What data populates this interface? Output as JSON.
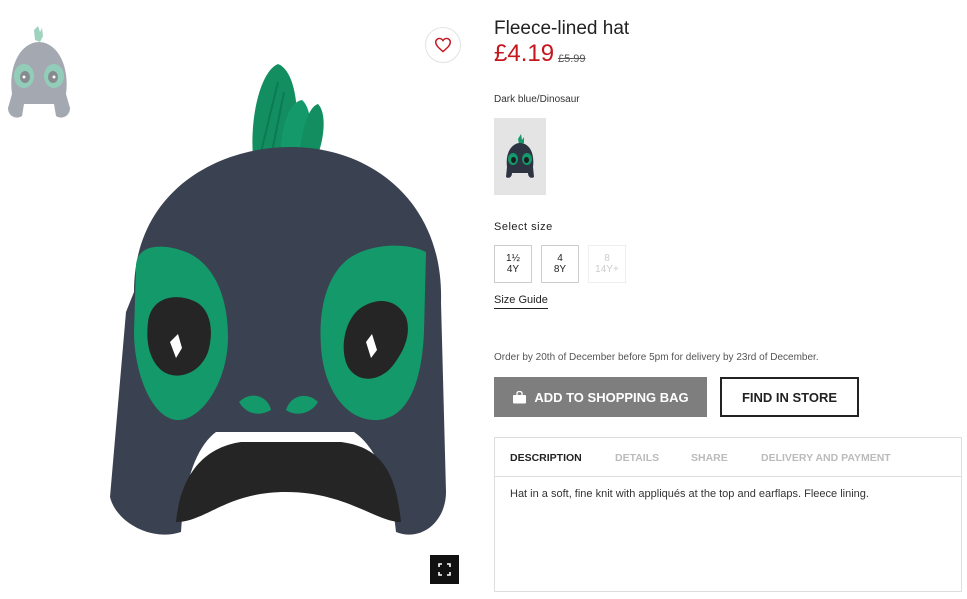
{
  "product": {
    "title": "Fleece-lined hat",
    "price": "£4.19",
    "old_price": "£5.99",
    "color_name": "Dark blue/Dinosaur"
  },
  "size_section": {
    "label": "Select size",
    "sizes": [
      {
        "line1": "1½",
        "line2": "4Y",
        "available": true
      },
      {
        "line1": "4",
        "line2": "8Y",
        "available": true
      },
      {
        "line1": "8",
        "line2": "14Y+",
        "available": false
      }
    ],
    "guide_label": "Size Guide"
  },
  "delivery_note": "Order by 20th of December before 5pm for delivery by 23rd of December.",
  "actions": {
    "add_to_bag_label": "ADD TO SHOPPING BAG",
    "find_in_store_label": "FIND IN STORE"
  },
  "tabs": {
    "items": [
      {
        "label": "DESCRIPTION",
        "active": true
      },
      {
        "label": "DETAILS",
        "active": false
      },
      {
        "label": "SHARE",
        "active": false
      },
      {
        "label": "DELIVERY AND PAYMENT",
        "active": false
      }
    ],
    "description_text": "Hat in a soft, fine knit with appliqués at the top and earflaps. Fleece lining."
  },
  "icons": {
    "favorite": "heart-icon",
    "zoom": "fullscreen-icon",
    "bag": "shopping-bag-icon"
  },
  "colors": {
    "price_red": "#c5161d",
    "hat_navy": "#3a4150",
    "hat_green": "#14996a",
    "bag_button_gray": "#7e7e7e"
  }
}
